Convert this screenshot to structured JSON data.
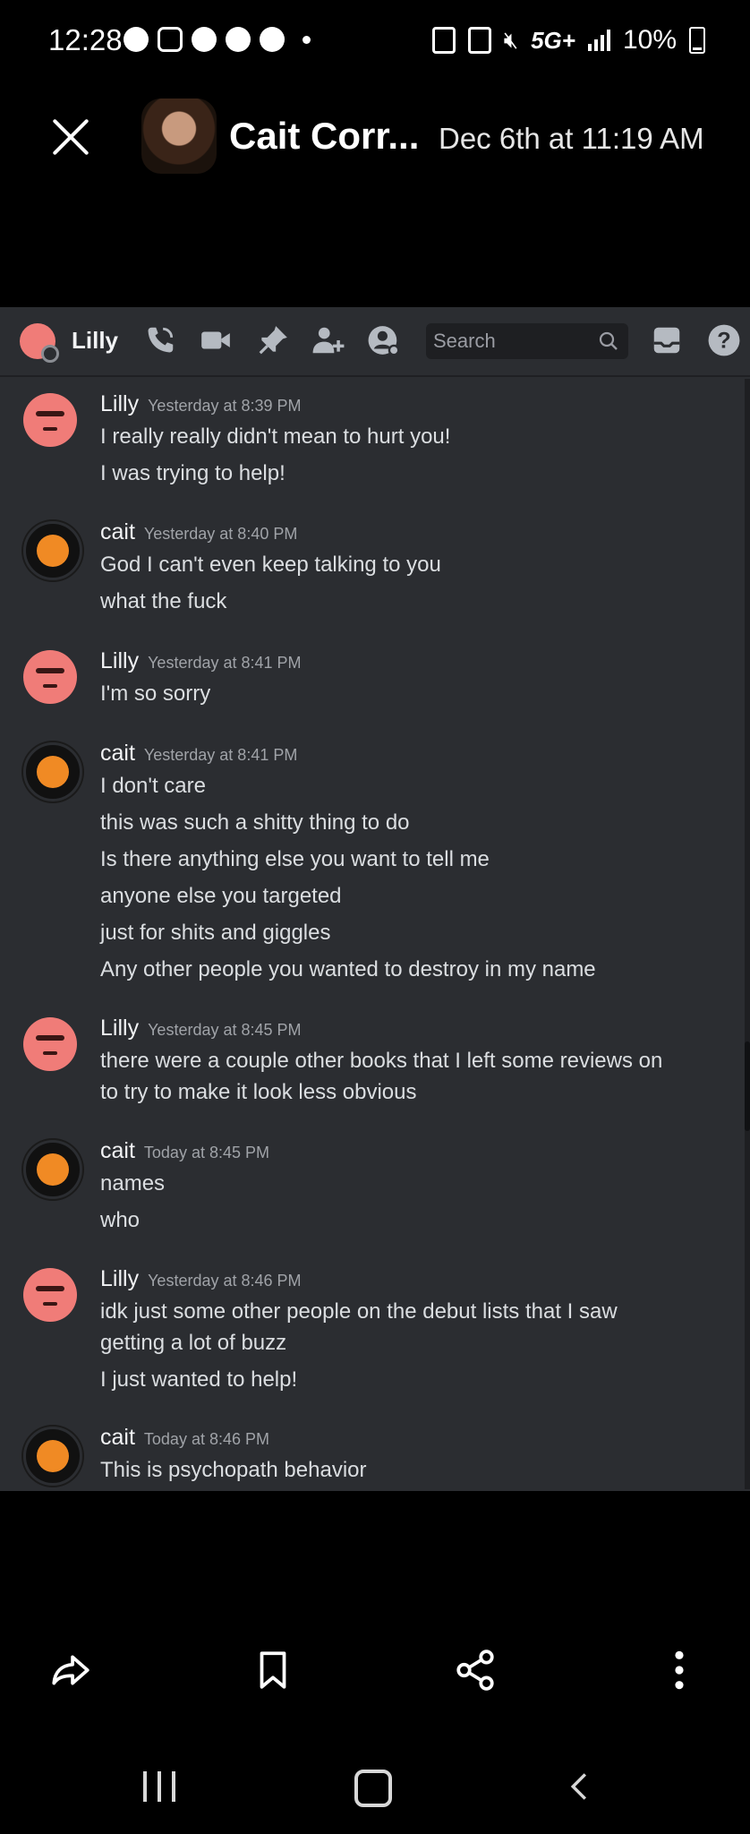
{
  "status_bar": {
    "time": "12:28",
    "network": "5G+",
    "battery": "10%"
  },
  "viewer": {
    "contact_name": "Cait Corr...",
    "date": "Dec 6th at 11:19 AM"
  },
  "discord": {
    "channel_user": "Lilly",
    "search_placeholder": "Search",
    "messages": [
      {
        "author": "Lilly",
        "time": "Yesterday at 8:39 PM",
        "lines": [
          "I really really didn't mean to hurt you!",
          "I was trying to help!"
        ]
      },
      {
        "author": "cait",
        "time": "Yesterday at 8:40 PM",
        "lines": [
          "God I can't even keep talking to you",
          "what the fuck"
        ]
      },
      {
        "author": "Lilly",
        "time": "Yesterday at 8:41 PM",
        "lines": [
          "I'm so sorry"
        ]
      },
      {
        "author": "cait",
        "time": "Yesterday at 8:41 PM",
        "lines": [
          "I don't care",
          "this was such a shitty thing to do",
          "Is there anything else you want to tell me",
          "anyone else you targeted",
          "just for shits and giggles",
          "Any other people you wanted to destroy in my name"
        ]
      },
      {
        "author": "Lilly",
        "time": "Yesterday at 8:45 PM",
        "lines": [
          "there were a couple other books that I left some reviews on",
          "to try to make it look less obvious"
        ]
      },
      {
        "author": "cait",
        "time": "Today at 8:45 PM",
        "lines": [
          "names",
          "who"
        ]
      },
      {
        "author": "Lilly",
        "time": "Yesterday at 8:46 PM",
        "lines": [
          "idk just some other people on the debut lists that I saw",
          "getting a lot of buzz",
          "I just wanted to help!"
        ]
      },
      {
        "author": "cait",
        "time": "Today at 8:46 PM",
        "lines": [
          "This is psychopath behavior"
        ]
      }
    ]
  }
}
